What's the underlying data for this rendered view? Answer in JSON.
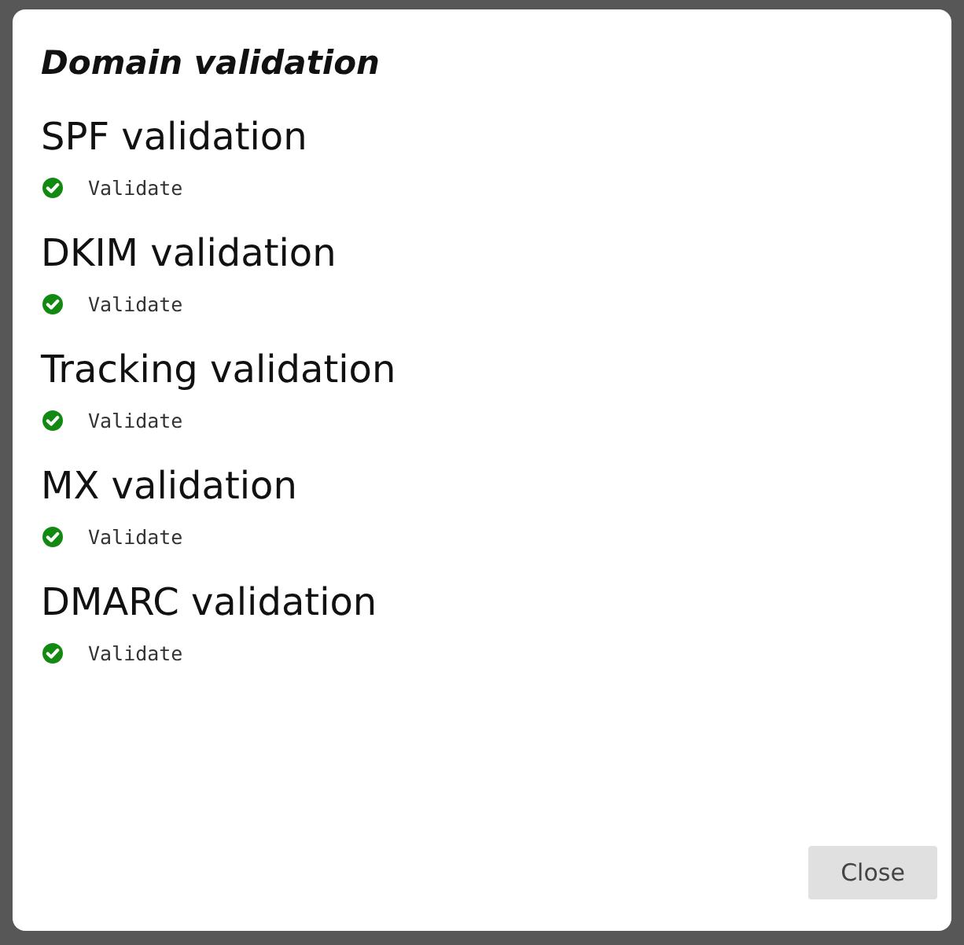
{
  "dialog": {
    "title": "Domain validation",
    "checks": [
      {
        "heading": "SPF validation",
        "valid": true,
        "label": "Validate"
      },
      {
        "heading": "DKIM validation",
        "valid": true,
        "label": "Validate"
      },
      {
        "heading": "Tracking validation",
        "valid": true,
        "label": "Validate"
      },
      {
        "heading": "MX validation",
        "valid": true,
        "label": "Validate"
      },
      {
        "heading": "DMARC validation",
        "valid": true,
        "label": "Validate"
      }
    ],
    "buttons": [
      "Close"
    ]
  }
}
